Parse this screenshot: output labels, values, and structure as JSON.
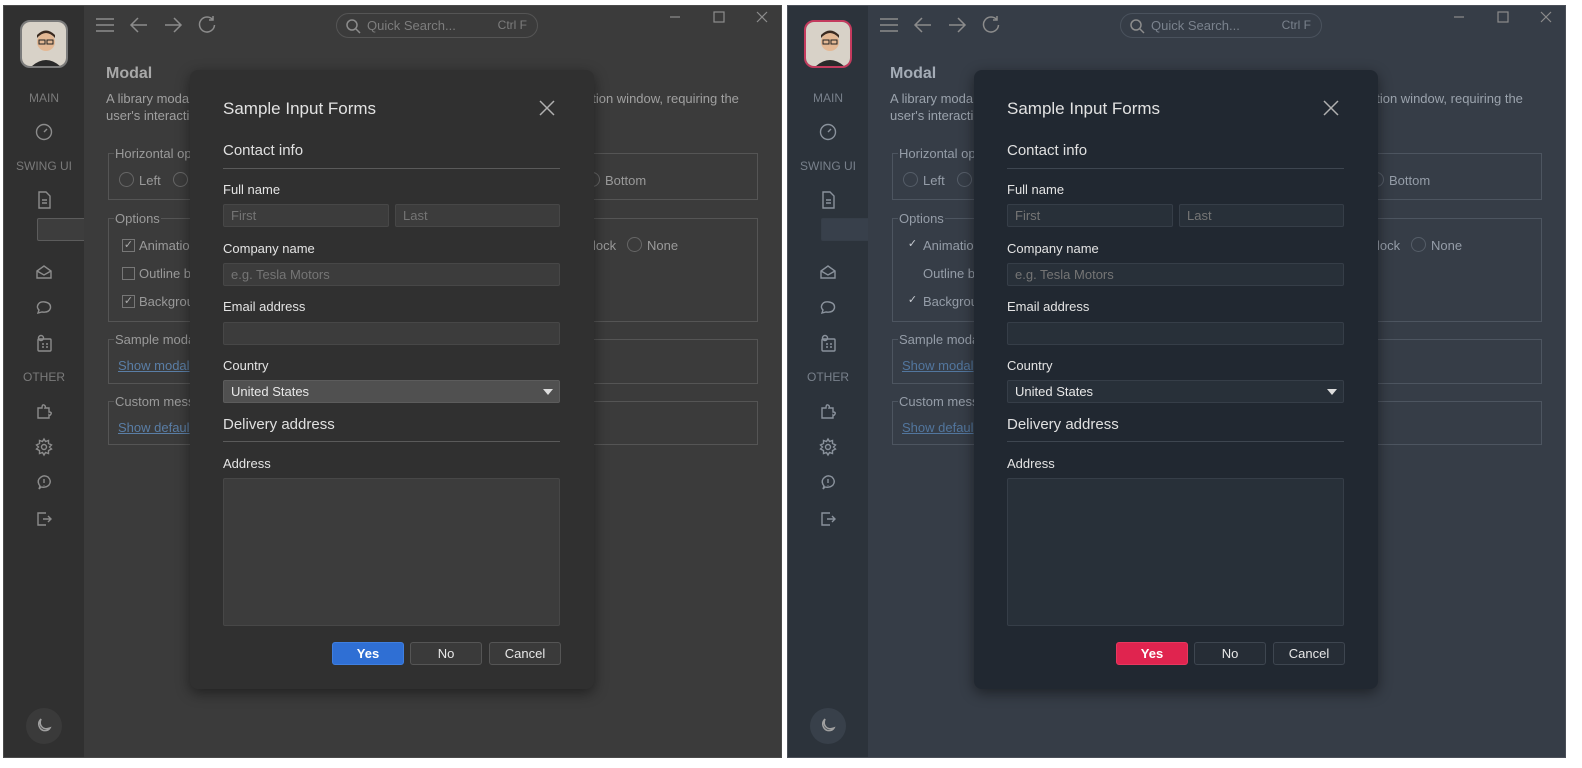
{
  "app": {
    "sections": {
      "main": "MAIN",
      "swing": "SWING UI",
      "other": "OTHER"
    },
    "search": {
      "placeholder": "Quick Search...",
      "shortcut": "Ctrl F"
    },
    "page": {
      "title": "Modal",
      "description_start": "A library modal",
      "description_end": "ation window, requiring the",
      "description_line2": "user's interacti"
    },
    "groups": {
      "horizontal": {
        "legend": "Horizontal opt",
        "option_left": "Left",
        "option_bottom": "Bottom"
      },
      "options": {
        "legend": "Options",
        "animation": "Animatio",
        "outline": "Outline b",
        "background": "Backgrou",
        "block": "lock",
        "none": "None"
      },
      "sample": {
        "legend": "Sample moda",
        "link": "Show modal"
      },
      "custom": {
        "legend": "Custom mess",
        "link": "Show defaul"
      }
    },
    "checkbox_state": {
      "animation": true,
      "outline": false,
      "background": true
    }
  },
  "modal": {
    "title": "Sample Input Forms",
    "contact_header": "Contact info",
    "full_name_label": "Full name",
    "first_placeholder": "First",
    "last_placeholder": "Last",
    "company_label": "Company name",
    "company_placeholder": "e.g. Tesla Motors",
    "email_label": "Email address",
    "email_value": "",
    "country_label": "Country",
    "country_value": "United States",
    "delivery_header": "Delivery address",
    "address_label": "Address",
    "address_value": "",
    "yes": "Yes",
    "no": "No",
    "cancel": "Cancel"
  },
  "themes": {
    "dark": {
      "accent": "#2f6fd4",
      "background": "#3b3b3b"
    },
    "dark_blue": {
      "accent": "#e0244f",
      "background": "#363d47"
    }
  },
  "icons": {
    "toolbar": [
      "menu-icon",
      "back-arrow-icon",
      "forward-arrow-icon",
      "refresh-icon"
    ],
    "sidebar": [
      "dashboard-icon",
      "document-icon",
      "copy-icon",
      "inbox-icon",
      "chat-icon",
      "calendar-icon",
      "puzzle-icon",
      "gear-icon",
      "alert-icon",
      "logout-icon"
    ],
    "window": [
      "minimize-icon",
      "maximize-icon",
      "close-icon"
    ],
    "theme_toggle": "moon-icon"
  }
}
